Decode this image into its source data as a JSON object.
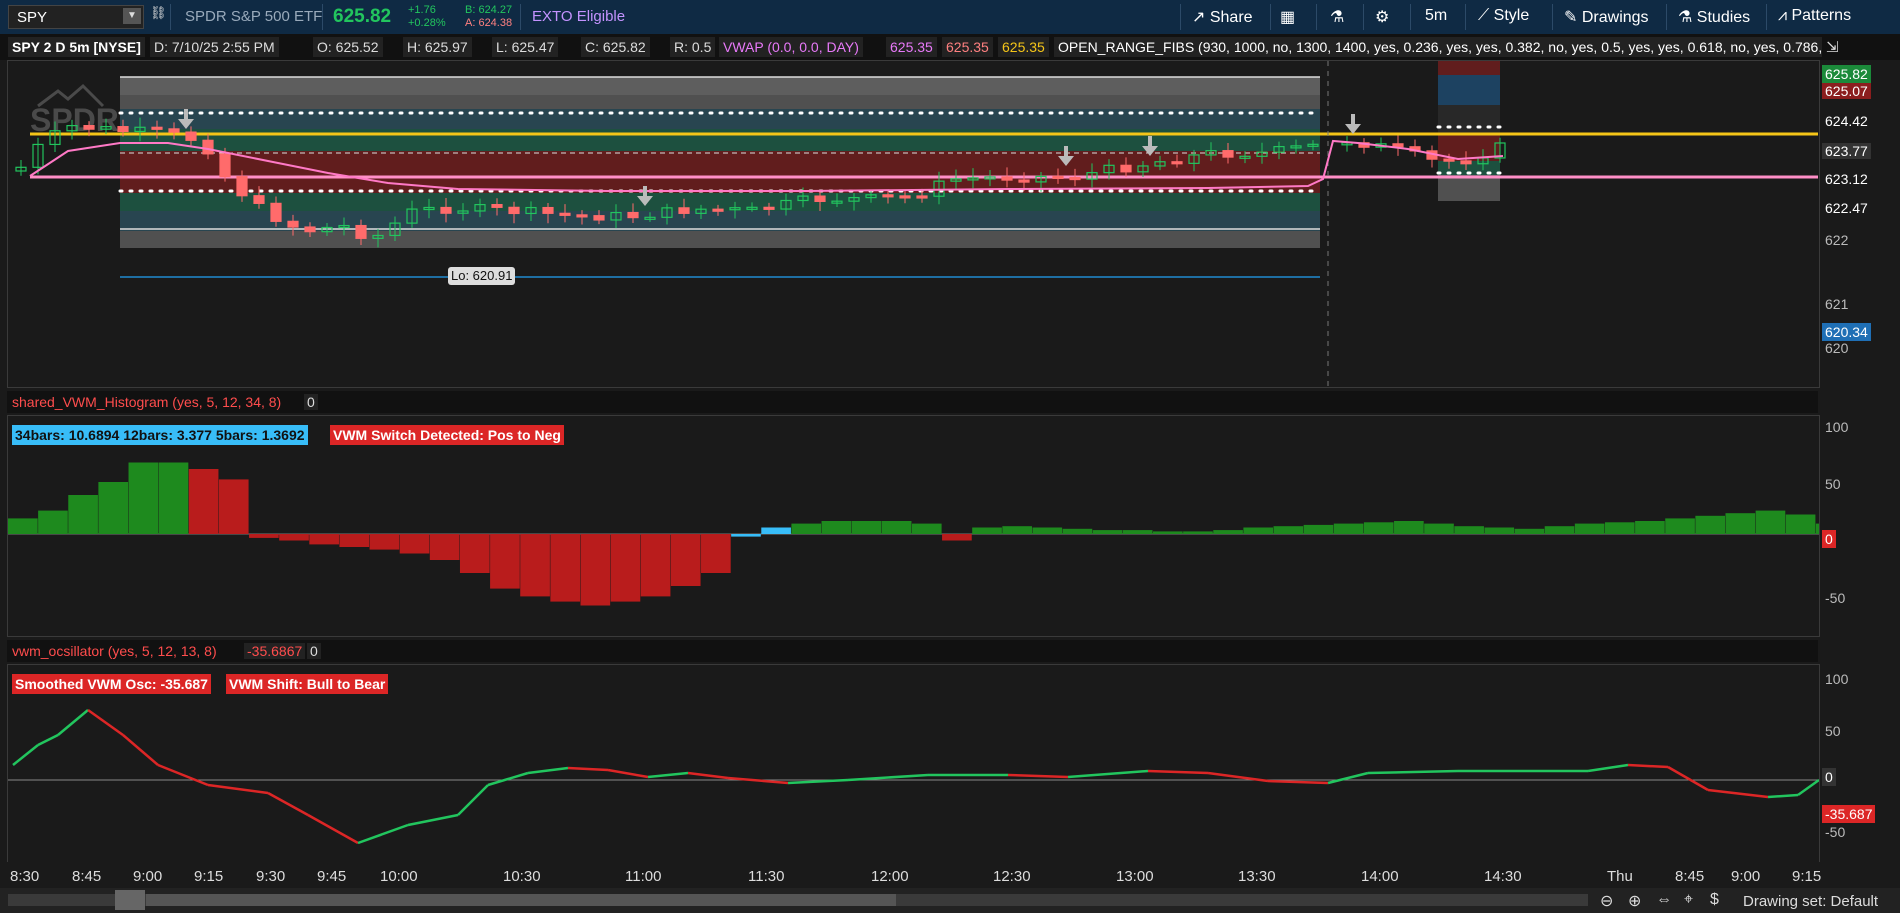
{
  "toolbar": {
    "symbol": "SPY",
    "description": "SPDR S&P 500 ETF",
    "last": "625.82",
    "change": "+1.76",
    "change_pct": "+0.28%",
    "bid": "B: 624.27",
    "ask": "A: 624.38",
    "exto": "EXTO Eligible",
    "share": "Share",
    "timeframe": "5m",
    "style": "Style",
    "drawings": "Drawings",
    "studies": "Studies",
    "patterns": "Patterns"
  },
  "infobar": {
    "title": "SPY 2 D 5m [NYSE]",
    "date": "D: 7/10/25 2:55 PM",
    "open": "O: 625.52",
    "high": "H: 625.97",
    "low": "L: 625.47",
    "close": "C: 625.82",
    "range": "R: 0.5",
    "vwap": "VWAP (0.0, 0.0, DAY)",
    "vwap1": "625.35",
    "vwap2": "625.35",
    "vwap3": "625.35",
    "fibs": "OPEN_RANGE_FIBS (930, 1000, no, 1300, 1400, yes, 0.236, yes, yes, 0.382, no, yes, 0.5, yes, yes, 0.618, no, yes, 0.786, no, yes,..."
  },
  "price_pane": {
    "axis_labels": [
      "625.07",
      "624.42",
      "623.77",
      "623.12",
      "622.47",
      "622",
      "621",
      "620"
    ],
    "tag_last": "625.82",
    "tag_low": "620.34",
    "lo_callout": "Lo: 620.91",
    "colors": {
      "up": "#22c55e",
      "down": "#ff6b6b",
      "vwap": "#ff79c6",
      "yellow": "#f5c518",
      "pink": "#ff8fc7"
    }
  },
  "histogram": {
    "header": "shared_VWM_Histogram (yes, 5, 12, 34, 8)",
    "header_val": "0",
    "badge_info": "34bars: 10.6894 12bars: 3.377 5bars: 1.3692",
    "badge_switch": "VWM Switch Detected: Pos to Neg",
    "axis": [
      "100",
      "50",
      "0",
      "-50"
    ],
    "zero_tag": "0"
  },
  "oscillator": {
    "header": "vwm_ocsillator (yes, 5, 12, 13, 8)",
    "header_val1": "-35.6867",
    "header_val2": "0",
    "badge_osc": "Smoothed VWM Osc: -35.687",
    "badge_shift": "VWM Shift: Bull to Bear",
    "axis": [
      "100",
      "50",
      "0",
      "-50"
    ],
    "zero_tag": "0",
    "last_tag": "-35.687"
  },
  "xaxis": [
    "8:30",
    "8:45",
    "9:00",
    "9:15",
    "9:30",
    "9:45",
    "10:00",
    "10:30",
    "11:00",
    "11:30",
    "12:00",
    "12:30",
    "13:00",
    "13:30",
    "14:00",
    "14:30",
    "Thu",
    "8:45",
    "9:00",
    "9:15"
  ],
  "bottom": {
    "drawing_set": "Drawing set: Default"
  }
}
